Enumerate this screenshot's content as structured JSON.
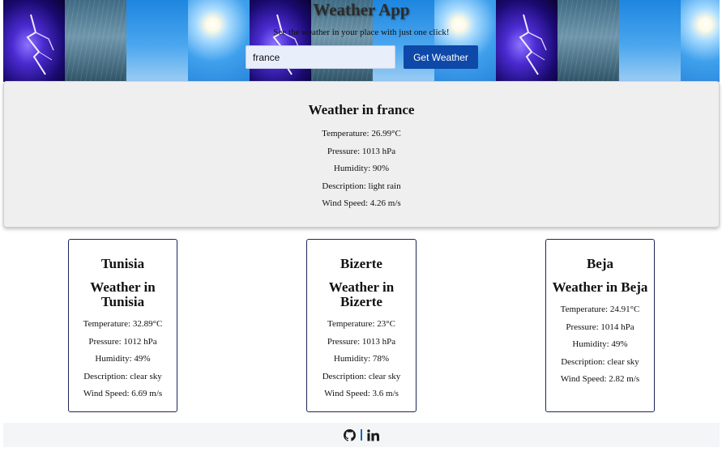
{
  "header": {
    "title": "Weather App",
    "subtitle": "See the weather in your place with just one click!",
    "search_value": "france",
    "button_label": "Get Weather",
    "background_tiles": [
      "storm",
      "rain",
      "sky",
      "sun",
      "storm",
      "rain",
      "sky",
      "sun",
      "storm",
      "rain",
      "sky",
      "sun"
    ]
  },
  "main": {
    "heading": "Weather in france",
    "temperature": "Temperature: 26.99°C",
    "pressure": "Pressure: 1013 hPa",
    "humidity": "Humidity: 90%",
    "description": "Description: light rain",
    "wind": "Wind Speed: 4.26 m/s"
  },
  "cards": [
    {
      "city": "Tunisia",
      "heading": "Weather in Tunisia",
      "temperature": "Temperature: 32.89°C",
      "pressure": "Pressure: 1012 hPa",
      "humidity": "Humidity: 49%",
      "description": "Description: clear sky",
      "wind": "Wind Speed: 6.69 m/s"
    },
    {
      "city": "Bizerte",
      "heading": "Weather in Bizerte",
      "temperature": "Temperature: 23°C",
      "pressure": "Pressure: 1013 hPa",
      "humidity": "Humidity: 78%",
      "description": "Description: clear sky",
      "wind": "Wind Speed: 3.6 m/s"
    },
    {
      "city": "Beja",
      "heading": "Weather in Beja",
      "temperature": "Temperature: 24.91°C",
      "pressure": "Pressure: 1014 hPa",
      "humidity": "Humidity: 49%",
      "description": "Description: clear sky",
      "wind": "Wind Speed: 2.82 m/s"
    }
  ],
  "footer": {
    "icons": [
      "github-icon",
      "linkedin-icon"
    ]
  },
  "colors": {
    "button": "#0e48a8",
    "card_border": "#1c2559",
    "panel_bg": "#efefef",
    "footer_separator": "#1565c0"
  }
}
